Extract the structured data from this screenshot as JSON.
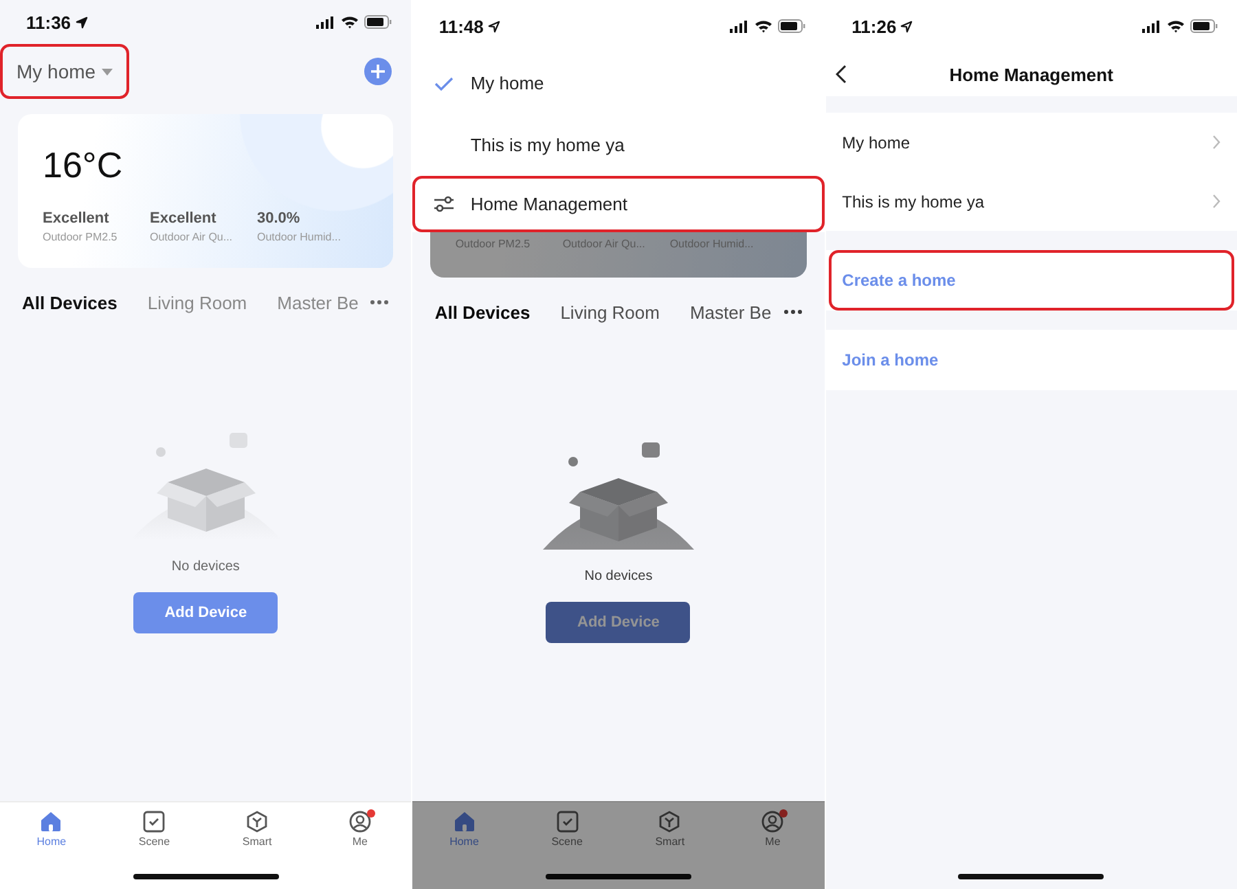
{
  "screens": [
    {
      "kind": "home",
      "time": "11:36",
      "location_filled": true,
      "home_selector": {
        "label": "My home",
        "highlighted": true
      },
      "weather": {
        "temperature": "16°C",
        "stats": [
          {
            "value": "Excellent",
            "label": "Outdoor PM2.5"
          },
          {
            "value": "Excellent",
            "label": "Outdoor Air Qu..."
          },
          {
            "value": "30.0%",
            "label": "Outdoor Humid..."
          }
        ]
      },
      "tabs": [
        {
          "label": "All Devices",
          "selected": true
        },
        {
          "label": "Living Room",
          "selected": false
        },
        {
          "label": "Master Be",
          "selected": false
        }
      ],
      "empty_text": "No devices",
      "add_button": "Add Device",
      "nav": [
        {
          "kind": "home",
          "label": "Home",
          "selected": true,
          "badge": false
        },
        {
          "kind": "scene",
          "label": "Scene",
          "selected": false,
          "badge": false
        },
        {
          "kind": "smart",
          "label": "Smart",
          "selected": false,
          "badge": false
        },
        {
          "kind": "me",
          "label": "Me",
          "selected": false,
          "badge": true
        }
      ]
    },
    {
      "kind": "home_menu",
      "time": "11:48",
      "location_filled": false,
      "menu": [
        {
          "kind": "home",
          "label": "My home",
          "checked": true,
          "highlighted": false
        },
        {
          "kind": "home",
          "label": "This is my home ya",
          "checked": false,
          "highlighted": false
        },
        {
          "kind": "manage",
          "label": "Home Management",
          "highlighted": true
        }
      ],
      "weather": {
        "stats": [
          {
            "label": "Outdoor PM2.5"
          },
          {
            "label": "Outdoor Air Qu..."
          },
          {
            "label": "Outdoor Humid..."
          }
        ]
      },
      "tabs": [
        {
          "label": "All Devices",
          "selected": true
        },
        {
          "label": "Living Room",
          "selected": false
        },
        {
          "label": "Master Be",
          "selected": false
        }
      ],
      "empty_text": "No devices",
      "add_button": "Add Device",
      "nav": [
        {
          "kind": "home",
          "label": "Home",
          "selected": true,
          "badge": false
        },
        {
          "kind": "scene",
          "label": "Scene",
          "selected": false,
          "badge": false
        },
        {
          "kind": "smart",
          "label": "Smart",
          "selected": false,
          "badge": false
        },
        {
          "kind": "me",
          "label": "Me",
          "selected": false,
          "badge": true
        }
      ]
    },
    {
      "kind": "manage",
      "time": "11:26",
      "location_filled": false,
      "title": "Home Management",
      "homes": [
        {
          "label": "My home"
        },
        {
          "label": "This is my home ya"
        }
      ],
      "actions": [
        {
          "label": "Create a home",
          "highlighted": true
        },
        {
          "label": "Join a home",
          "highlighted": false
        }
      ]
    }
  ]
}
